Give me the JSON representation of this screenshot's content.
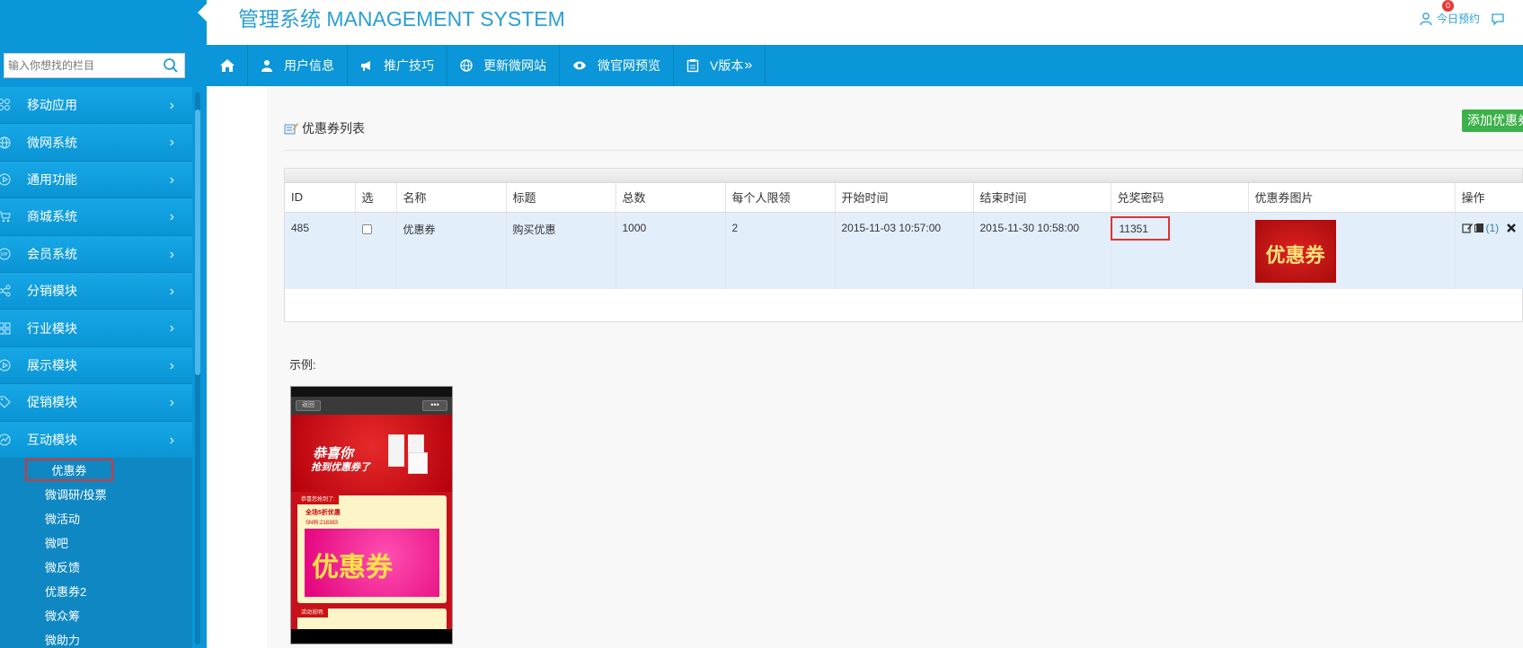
{
  "header": {
    "title": "管理系统 MANAGEMENT SYSTEM",
    "appointment_label": "今日预约",
    "appointment_badge": "0"
  },
  "search": {
    "placeholder": "输入你想找的栏目"
  },
  "menu": {
    "items": [
      {
        "label": "移动应用",
        "icon": "apps-icon"
      },
      {
        "label": "微网系统",
        "icon": "globe-icon"
      },
      {
        "label": "通用功能",
        "icon": "play-icon"
      },
      {
        "label": "商城系统",
        "icon": "cart-icon"
      },
      {
        "label": "会员系统",
        "icon": "vip-icon"
      },
      {
        "label": "分销模块",
        "icon": "share-icon"
      },
      {
        "label": "行业模块",
        "icon": "grid-icon"
      },
      {
        "label": "展示模块",
        "icon": "play-icon"
      },
      {
        "label": "促销模块",
        "icon": "tag-icon"
      },
      {
        "label": "互动模块",
        "icon": "chart-icon"
      }
    ],
    "subitems": [
      "优惠券",
      "微调研/投票",
      "微活动",
      "微吧",
      "微反馈",
      "优惠券2",
      "微众筹",
      "微助力"
    ]
  },
  "navbar": {
    "items": [
      "用户信息",
      "推广技巧",
      "更新微网站",
      "微官网预览",
      "V版本"
    ]
  },
  "panel": {
    "title": "优惠券列表",
    "add_button": "添加优惠券"
  },
  "table": {
    "headers": [
      "ID",
      "选",
      "名称",
      "标题",
      "总数",
      "每个人限领",
      "开始时间",
      "结束时间",
      "兑奖密码",
      "优惠券图片",
      "操作"
    ],
    "row": {
      "id": "485",
      "name": "优惠券",
      "title": "购买优惠",
      "total": "1000",
      "limit": "2",
      "start": "2015-11-03 10:57:00",
      "end": "2015-11-30 10:58:00",
      "password": "11351",
      "image_text": "优惠券",
      "op_count": "(1)"
    }
  },
  "example": {
    "label": "示例:",
    "phone_back": "返回",
    "phone_more": "•••",
    "hero_line1": "恭喜你",
    "hero_line2": "抢到优惠券了",
    "card_tag": "恭喜您抢到了:",
    "card_line1": "全场5折优惠",
    "card_line2": "SN码:218383",
    "card_big": "优惠券",
    "card2_tag": "活动说明:"
  },
  "colors": {
    "primary": "#0a96d8",
    "accent_red": "#e0332f",
    "green": "#3cb04a"
  }
}
